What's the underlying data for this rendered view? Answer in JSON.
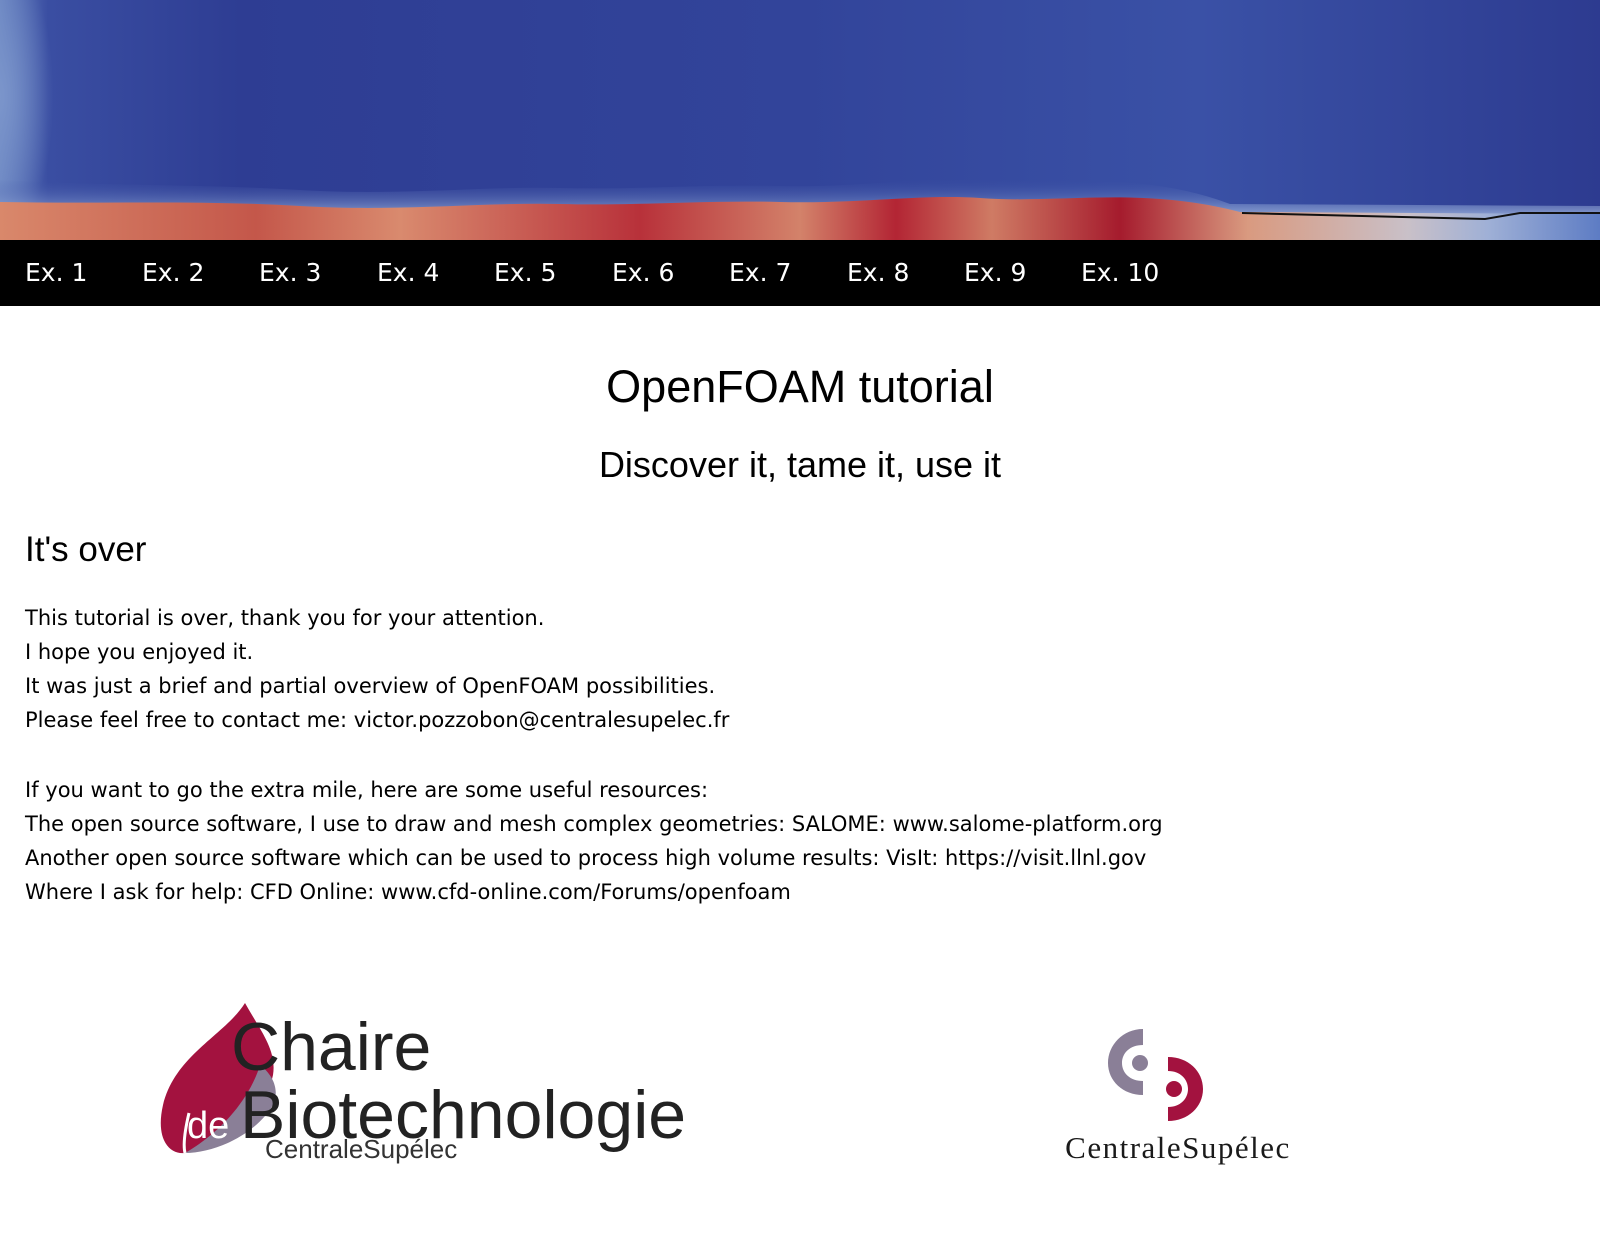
{
  "nav": {
    "items": [
      {
        "label": "Ex. 1"
      },
      {
        "label": "Ex. 2"
      },
      {
        "label": "Ex. 3"
      },
      {
        "label": "Ex. 4"
      },
      {
        "label": "Ex. 5"
      },
      {
        "label": "Ex. 6"
      },
      {
        "label": "Ex. 7"
      },
      {
        "label": "Ex. 8"
      },
      {
        "label": "Ex. 9"
      },
      {
        "label": "Ex. 10"
      }
    ]
  },
  "header": {
    "title": "OpenFOAM tutorial",
    "subtitle": "Discover it, tame it, use it"
  },
  "section": {
    "heading": "It's over",
    "paragraph1": [
      "This tutorial is over, thank you for your attention.",
      "I hope you enjoyed it.",
      "It was just a brief and partial overview of OpenFOAM possibilities.",
      "Please feel free to contact me: victor.pozzobon@centralesupelec.fr"
    ],
    "paragraph2": [
      "If you want to go the extra mile, here are some useful resources:",
      "The open source software, I use to draw and mesh complex geometries: SALOME: www.salome-platform.org",
      "Another open source software which can be used to process high volume results: VisIt: https://visit.llnl.gov",
      "Where I ask for help: CFD Online: www.cfd-online.com/Forums/openfoam"
    ]
  },
  "logos": {
    "chaire": {
      "line1": "Chaire",
      "line2_prefix": "de",
      "line2": "Biotechnologie",
      "line3": "CentraleSupélec"
    },
    "centrale": {
      "name": "CentraleSupélec"
    }
  },
  "colors": {
    "nav_background": "#000000",
    "nav_text": "#ffffff",
    "banner_blue": "#2f3f94",
    "banner_red": "#b2182b",
    "logo_crimson": "#a3123f",
    "logo_grey": "#8a7f97",
    "logo_text": "#222222"
  },
  "icons": {
    "chaire_logo": "leaf-logo-icon",
    "centrale_logo": "centralesupelec-emblem-icon"
  }
}
